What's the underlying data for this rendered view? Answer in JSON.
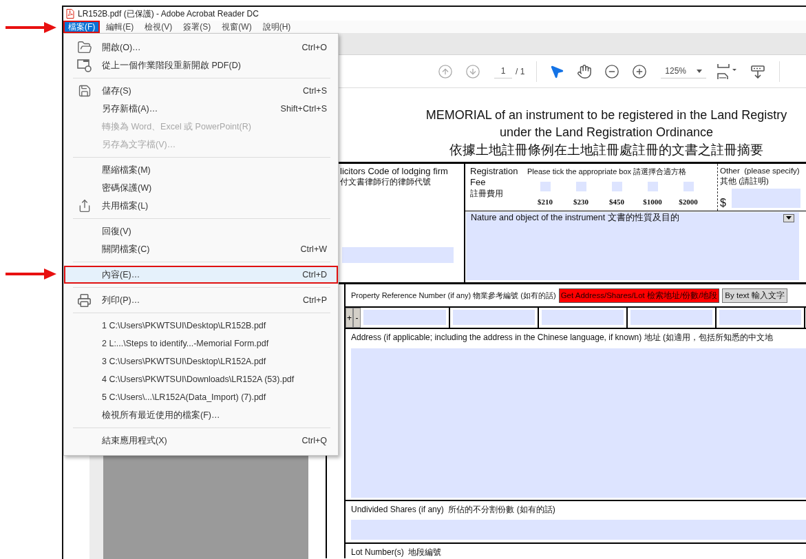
{
  "window": {
    "title": "LR152B.pdf (已保護) - Adobe Acrobat Reader DC"
  },
  "menu_bar": [
    {
      "label": "檔案(F)",
      "selected": true,
      "annotated": true
    },
    {
      "label": "編輯(E)",
      "selected": false,
      "annotated": false
    },
    {
      "label": "檢視(V)",
      "selected": false,
      "annotated": false
    },
    {
      "label": "簽署(S)",
      "selected": false,
      "annotated": false
    },
    {
      "label": "視窗(W)",
      "selected": false,
      "annotated": false
    },
    {
      "label": "說明(H)",
      "selected": false,
      "annotated": false
    }
  ],
  "toolbar": {
    "page": "1",
    "page_count": "/ 1",
    "zoom": "125%",
    "tools": [
      {
        "kind": "select",
        "selected": true
      },
      {
        "kind": "hand",
        "selected": false
      }
    ]
  },
  "file_menu": [
    {
      "kind": "item",
      "label": "開啟(O)…",
      "shortcut": "Ctrl+O",
      "disabled": false,
      "highlighted": false,
      "annotated": false
    },
    {
      "kind": "item",
      "label": "從上一個作業階段重新開啟 PDF(D)",
      "disabled": false,
      "highlighted": false,
      "annotated": false
    },
    {
      "kind": "separator"
    },
    {
      "kind": "item",
      "label": "儲存(S)",
      "shortcut": "Ctrl+S",
      "disabled": false,
      "highlighted": false,
      "annotated": false
    },
    {
      "kind": "item",
      "label": "另存新檔(A)…",
      "shortcut": "Shift+Ctrl+S",
      "disabled": false,
      "highlighted": false,
      "annotated": false
    },
    {
      "kind": "item",
      "label": "轉換為 Word、Excel 或 PowerPoint(R)",
      "disabled": true,
      "highlighted": false,
      "annotated": false
    },
    {
      "kind": "item",
      "label": "另存為文字檔(V)…",
      "disabled": true,
      "highlighted": false,
      "annotated": false
    },
    {
      "kind": "separator"
    },
    {
      "kind": "item",
      "label": "壓縮檔案(M)",
      "disabled": false,
      "highlighted": false,
      "annotated": false
    },
    {
      "kind": "item",
      "label": "密碼保護(W)",
      "disabled": false,
      "highlighted": false,
      "annotated": false
    },
    {
      "kind": "item",
      "label": "共用檔案(L)",
      "disabled": false,
      "highlighted": false,
      "annotated": false
    },
    {
      "kind": "separator"
    },
    {
      "kind": "item",
      "label": "回復(V)",
      "disabled": false,
      "highlighted": false,
      "annotated": false
    },
    {
      "kind": "item",
      "label": "關閉檔案(C)",
      "shortcut": "Ctrl+W",
      "disabled": false,
      "highlighted": false,
      "annotated": false
    },
    {
      "kind": "separator"
    },
    {
      "kind": "item",
      "label": "內容(E)…",
      "shortcut": "Ctrl+D",
      "disabled": false,
      "highlighted": true,
      "annotated": true
    },
    {
      "kind": "separator"
    },
    {
      "kind": "item",
      "label": "列印(P)…",
      "shortcut": "Ctrl+P",
      "disabled": false,
      "highlighted": false,
      "annotated": false
    },
    {
      "kind": "separator"
    },
    {
      "kind": "item",
      "label": "1 C:\\Users\\PKWTSUI\\Desktop\\LR152B.pdf",
      "disabled": false,
      "highlighted": false,
      "annotated": false
    },
    {
      "kind": "item",
      "label": "2 L:...\\Steps to identify...-Memorial Form.pdf",
      "disabled": false,
      "highlighted": false,
      "annotated": false
    },
    {
      "kind": "item",
      "label": "3 C:\\Users\\PKWTSUI\\Desktop\\LR152A.pdf",
      "disabled": false,
      "highlighted": false,
      "annotated": false
    },
    {
      "kind": "item",
      "label": "4 C:\\Users\\PKWTSUI\\Downloads\\LR152A (53).pdf",
      "disabled": false,
      "highlighted": false,
      "annotated": false
    },
    {
      "kind": "item",
      "label": "5 C:\\Users\\...\\LR152A(Data_Import) (7).pdf",
      "disabled": false,
      "highlighted": false,
      "annotated": false
    },
    {
      "kind": "item",
      "label": "檢視所有最近使用的檔案(F)…",
      "disabled": false,
      "highlighted": false,
      "annotated": false
    },
    {
      "kind": "separator"
    },
    {
      "kind": "item",
      "label": "結束應用程式(X)",
      "shortcut": "Ctrl+Q",
      "disabled": false,
      "highlighted": false,
      "annotated": false
    }
  ],
  "document": {
    "title_lines": [
      "MEMORIAL of an instrument to be registered in the Land Registry",
      "under the Land Registration Ordinance",
      "依據土地註冊條例在土地註冊處註冊的文書之註冊摘要"
    ],
    "solicitor": {
      "label_en": "licitors Code of lodging firm",
      "label_zh": "付文書律師行的律師代號"
    },
    "registration_fee": {
      "label_lines": [
        "Registration",
        "Fee",
        "註冊費用"
      ],
      "instruction": "Please tick the appropriate box 請選擇合適方格",
      "options": [
        {
          "amount": "$210",
          "checked": false
        },
        {
          "amount": "$230",
          "checked": false
        },
        {
          "amount": "$450",
          "checked": false
        },
        {
          "amount": "$1000",
          "checked": false
        },
        {
          "amount": "$2000",
          "checked": false
        }
      ],
      "other_lines": [
        "Other  (please specify)",
        "其他 (請註明)"
      ],
      "currency": "$"
    },
    "nature": {
      "label": "Nature and object of the instrument 文書的性質及目的"
    },
    "property_reference": {
      "label": "Property Reference Number (if any) 物業參考編號 (如有的話)",
      "lookup_button": "Get Address/Shares/Lot 檢索地址/份數/地段",
      "text_button": "By text 輸入文字",
      "add": "+",
      "remove": "-"
    },
    "address": {
      "label": "Address (if applicable; including the address in the Chinese language, if known) 地址 (如適用，包括所知悉的中文地"
    },
    "undivided_shares": {
      "label": "Undivided Shares (if any)  所佔的不分割份數 (如有的話)"
    },
    "lot_number": {
      "label": "Lot Number(s)  地段編號"
    }
  }
}
